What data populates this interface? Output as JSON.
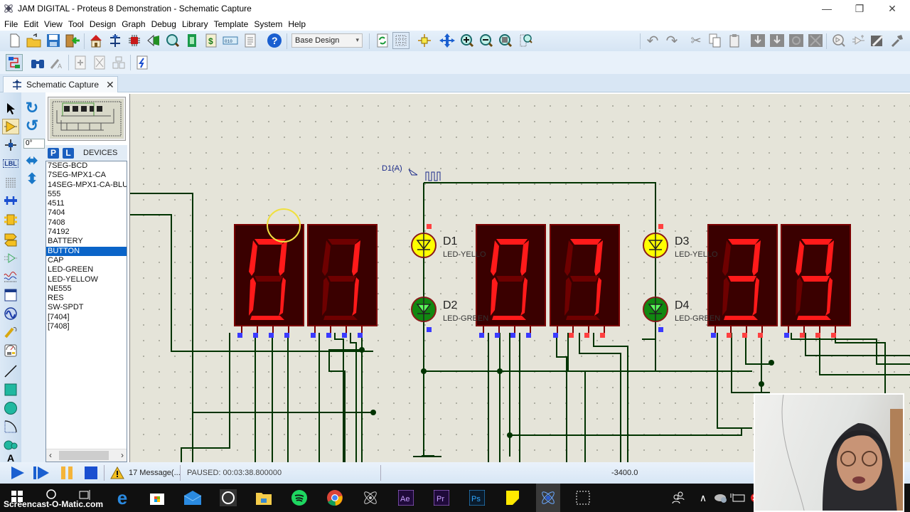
{
  "window": {
    "title": "JAM DIGITAL - Proteus 8 Demonstration - Schematic Capture",
    "minimize": "—",
    "maximize": "❐",
    "close": "✕"
  },
  "menu": [
    "File",
    "Edit",
    "View",
    "Tool",
    "Design",
    "Graph",
    "Debug",
    "Library",
    "Template",
    "System",
    "Help"
  ],
  "toolbar": {
    "row1_left": [
      "new-icon",
      "open-icon",
      "save-icon",
      "close-project-icon",
      "home-icon",
      "schematic-icon",
      "pcb-icon",
      "3d-view-icon",
      "gerber-icon",
      "design-explorer-icon",
      "bom-icon",
      "vsm-studio-icon",
      "notes-icon",
      "help-icon"
    ],
    "design_combo": "Base Design",
    "row1_view": [
      "refresh-icon",
      "grid-icon",
      "origin-icon",
      "pan-icon",
      "zoom-in-icon",
      "zoom-out-icon",
      "zoom-all-icon",
      "zoom-area-icon"
    ],
    "row1_right": [
      "undo-icon",
      "redo-icon",
      "cut-icon",
      "copy-icon",
      "paste-icon",
      "block-copy-icon",
      "block-move-icon",
      "block-rotate-icon",
      "block-delete-icon",
      "pick-device-icon",
      "make-device-icon",
      "packaging-icon",
      "decompose-icon"
    ],
    "row2": [
      "wire-autorouter-icon",
      "search-tag-icon",
      "property-assign-icon",
      "new-sheet-icon",
      "remove-sheet-icon",
      "exit-to-parent-icon",
      "electrical-rule-check-icon"
    ]
  },
  "tabs": [
    {
      "label": "Schematic Capture",
      "close": "✕"
    }
  ],
  "left_tools": [
    "selection-mode",
    "component-mode",
    "junction-dot",
    "wire-label",
    "text-script",
    "buses",
    "subcircuit",
    "terminals",
    "device-pins",
    "graph",
    "tape-recorder",
    "generators",
    "voltage-probe",
    "virtual-instruments",
    "2d-line",
    "2d-box",
    "2d-circle",
    "2d-arc",
    "2d-path",
    "2d-text"
  ],
  "orientation": {
    "angle": "0°"
  },
  "devices": {
    "header_p": "P",
    "header_l": "L",
    "title": "DEVICES",
    "items": [
      "7SEG-BCD",
      "7SEG-MPX1-CA",
      "14SEG-MPX1-CA-BLU",
      "555",
      "4511",
      "7404",
      "7408",
      "74192",
      "BATTERY",
      "BUTTON",
      "CAP",
      "LED-GREEN",
      "LED-YELLOW",
      "NE555",
      "RES",
      "SW-SPDT",
      "[7404]",
      "[7408]"
    ],
    "selected": "BUTTON"
  },
  "schematic": {
    "clock_label": "D1(A)",
    "displays": [
      {
        "digit": "0"
      },
      {
        "digit": "1"
      },
      {
        "digit": "0"
      },
      {
        "digit": "7"
      },
      {
        "digit": "3"
      },
      {
        "digit": "9"
      }
    ],
    "leds": [
      {
        "ref": "D1",
        "type": "LED-YELLOW",
        "color": "#ffff00"
      },
      {
        "ref": "D2",
        "type": "LED-GREEN",
        "color": "#1fbf1f"
      },
      {
        "ref": "D3",
        "type": "LED-YELLOW",
        "color": "#ffff00"
      },
      {
        "ref": "D4",
        "type": "LED-GREEN",
        "color": "#1fbf1f"
      }
    ],
    "colors": {
      "wire": "#003300",
      "segment_on": "#ff1a1a",
      "segment_off": "#6e0000",
      "display_body": "#3a0000",
      "pin_low": "#3a3aff",
      "pin_high": "#ff4040"
    }
  },
  "status": {
    "controls": [
      "play-icon",
      "step-icon",
      "pause-icon",
      "stop-icon"
    ],
    "messages": "17 Message(...",
    "sim_state": "PAUSED: 00:03:38.800000",
    "coordinate": "-3400.0"
  },
  "taskbar": {
    "watermark": "Screencast-O-Matic.com",
    "apps": [
      "windows-start",
      "cortana-search",
      "task-view",
      "edge",
      "store",
      "mail",
      "whatsapp",
      "file-explorer",
      "spotify",
      "chrome",
      "proteus-isis",
      "after-effects",
      "premiere-pro",
      "photoshop",
      "sticky-notes",
      "proteus-active",
      "snipping-tool"
    ],
    "tray": [
      "people-icon",
      "show-hidden-icon",
      "onedrive-icon",
      "battery-icon",
      "network-error-icon"
    ]
  }
}
